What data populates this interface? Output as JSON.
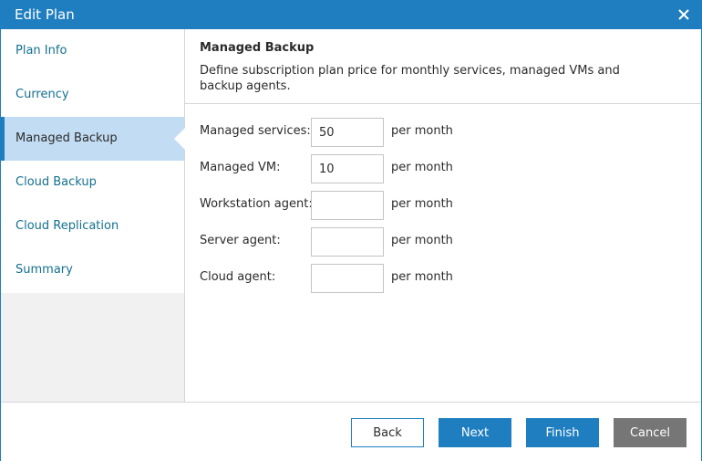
{
  "window": {
    "title": "Edit Plan",
    "close_icon": "close-icon"
  },
  "sidebar": {
    "items": [
      {
        "label": "Plan Info",
        "active": false
      },
      {
        "label": "Currency",
        "active": false
      },
      {
        "label": "Managed Backup",
        "active": true
      },
      {
        "label": "Cloud Backup",
        "active": false
      },
      {
        "label": "Cloud Replication",
        "active": false
      },
      {
        "label": "Summary",
        "active": false
      }
    ]
  },
  "main": {
    "heading": "Managed Backup",
    "description": "Define subscription plan price for monthly services, managed VMs and backup agents.",
    "fields": [
      {
        "label": "Managed services:",
        "value": "50",
        "unit": "per month"
      },
      {
        "label": "Managed VM:",
        "value": "10",
        "unit": "per month"
      },
      {
        "label": "Workstation agent:",
        "value": "",
        "unit": "per month"
      },
      {
        "label": "Server agent:",
        "value": "",
        "unit": "per month"
      },
      {
        "label": "Cloud agent:",
        "value": "",
        "unit": "per month"
      }
    ]
  },
  "footer": {
    "back_label": "Back",
    "next_label": "Next",
    "finish_label": "Finish",
    "cancel_label": "Cancel"
  },
  "colors": {
    "accent": "#1f7ec0",
    "active_nav_bg": "#c1dcf3",
    "link_text": "#13708f",
    "cancel_bg": "#767676"
  }
}
